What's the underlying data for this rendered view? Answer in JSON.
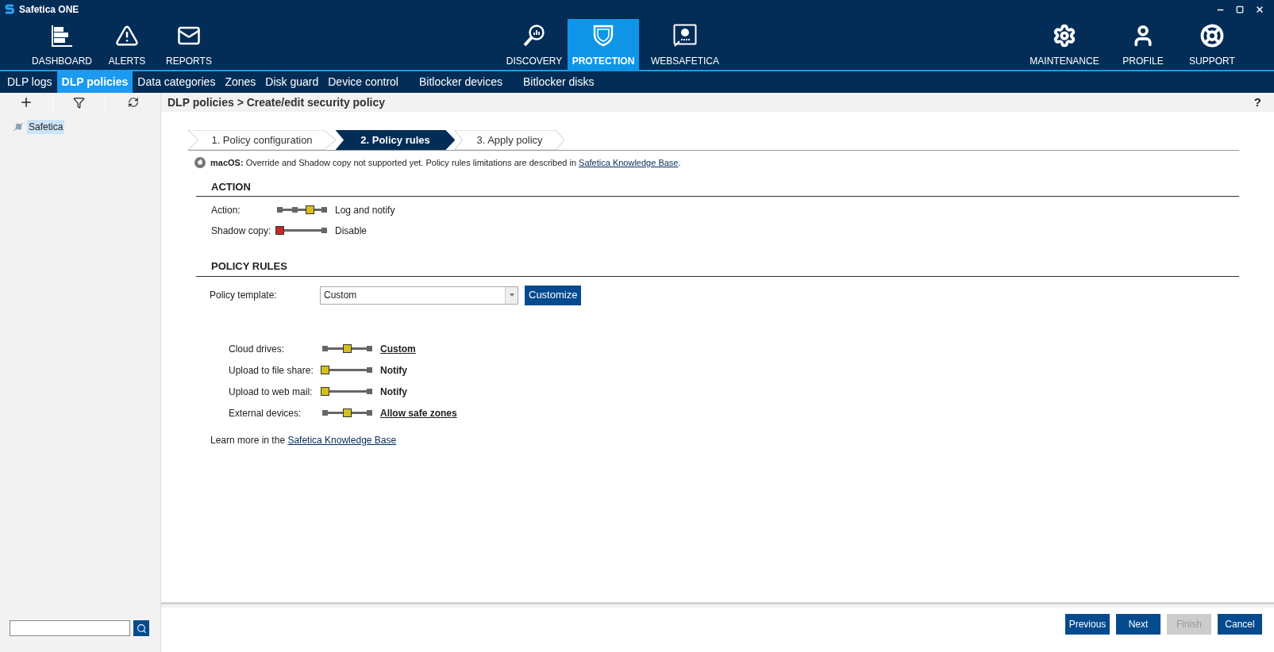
{
  "window": {
    "title": "Safetica ONE"
  },
  "main_nav": {
    "left": [
      {
        "label": "DASHBOARD",
        "selected": false
      },
      {
        "label": "ALERTS",
        "selected": false
      },
      {
        "label": "REPORTS",
        "selected": false
      }
    ],
    "center": [
      {
        "label": "DISCOVERY",
        "selected": false
      },
      {
        "label": "PROTECTION",
        "selected": true
      },
      {
        "label": "WEBSAFETICA",
        "selected": false
      }
    ],
    "right": [
      {
        "label": "MAINTENANCE",
        "selected": false
      },
      {
        "label": "PROFILE",
        "selected": false
      },
      {
        "label": "SUPPORT",
        "selected": false
      }
    ]
  },
  "sub_nav": [
    {
      "label": "DLP logs",
      "selected": false
    },
    {
      "label": "DLP policies",
      "selected": true
    },
    {
      "label": "Data categories",
      "selected": false
    },
    {
      "label": "Zones",
      "selected": false
    },
    {
      "label": "Disk guard",
      "selected": false
    },
    {
      "label": "Device control",
      "selected": false
    },
    {
      "label": "Bitlocker devices",
      "selected": false
    },
    {
      "label": "Bitlocker disks",
      "selected": false
    }
  ],
  "sidebar": {
    "tree": [
      {
        "label": "Safetica",
        "selected": true
      }
    ]
  },
  "breadcrumb": "DLP policies > Create/edit security policy",
  "help": "?",
  "wizard_steps": [
    {
      "label": "1. Policy configuration",
      "selected": false
    },
    {
      "label": "2. Policy rules",
      "selected": true
    },
    {
      "label": "3. Apply policy",
      "selected": false
    }
  ],
  "notice": {
    "prefix": "macOS:",
    "text": "Override and Shadow copy not supported yet. Policy rules limitations are described in",
    "link": "Safetica Knowledge Base",
    "suffix": "."
  },
  "action_section": {
    "title": "ACTION",
    "sliders": [
      {
        "label": "Action:",
        "kind": "four-step",
        "level": 0.67,
        "color": "#d4c017",
        "value": "Log and notify",
        "linked": false
      },
      {
        "label": "Shadow copy:",
        "kind": "two-step",
        "level": 0,
        "color": "#c62828",
        "value": "Disable",
        "linked": false
      }
    ]
  },
  "policy_rules_section": {
    "title": "POLICY RULES",
    "template": {
      "label": "Policy template:",
      "value": "Custom",
      "button": "Customize"
    },
    "rules": [
      {
        "label": "Cloud drives:",
        "kind": "three-step",
        "level": 0.5,
        "color": "#d4c017",
        "value": "Custom",
        "linked": true
      },
      {
        "label": "Upload to file share:",
        "kind": "two-step",
        "level": 0,
        "color": "#d4c017",
        "value": "Notify",
        "linked": false
      },
      {
        "label": "Upload to web mail:",
        "kind": "two-step",
        "level": 0,
        "color": "#d4c017",
        "value": "Notify",
        "linked": false
      },
      {
        "label": "External devices:",
        "kind": "three-step",
        "level": 0.5,
        "color": "#d4c017",
        "value": "Allow safe zones",
        "linked": true
      }
    ]
  },
  "learn_more": {
    "text": "Learn more in the",
    "link": "Safetica Knowledge Base"
  },
  "footer_buttons": [
    {
      "label": "Previous",
      "disabled": false
    },
    {
      "label": "Next",
      "disabled": false
    },
    {
      "label": "Finish",
      "disabled": true
    },
    {
      "label": "Cancel",
      "disabled": false
    }
  ]
}
